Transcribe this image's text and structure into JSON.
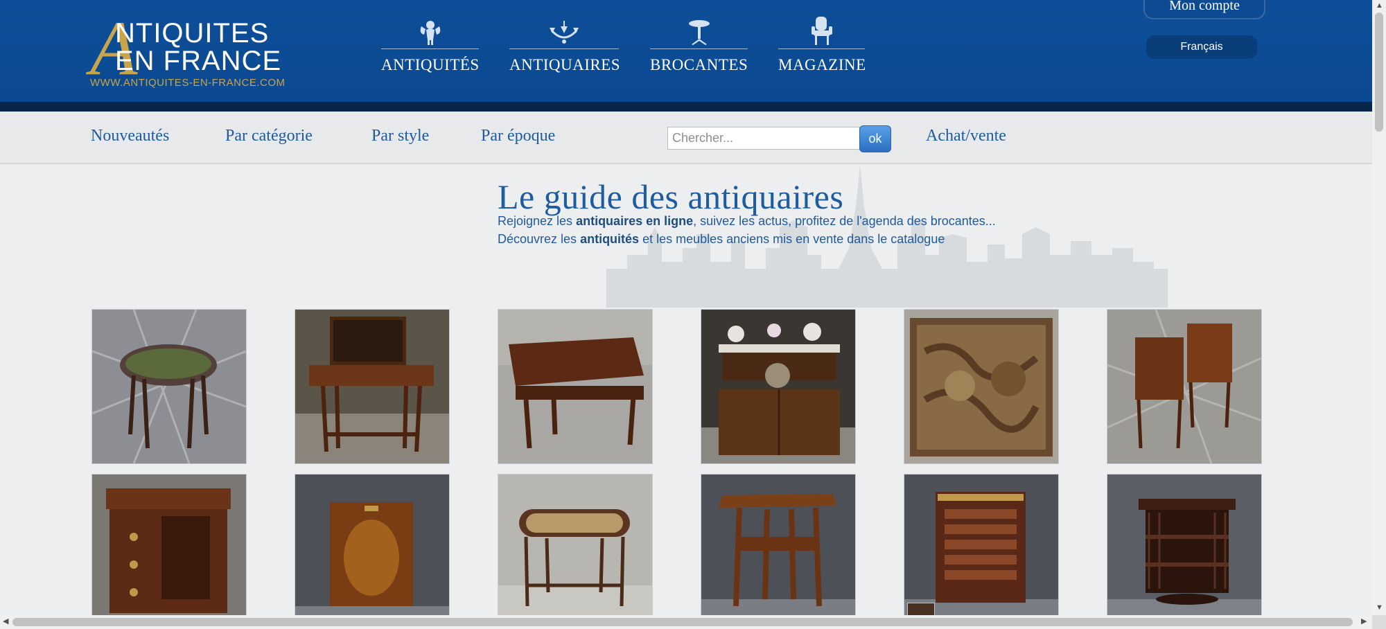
{
  "logo": {
    "letter": "A",
    "line1": "NTIQUITES",
    "line2": "EN FRANCE",
    "url": "WWW.ANTIQUITES-EN-FRANCE.COM"
  },
  "main_nav": [
    {
      "label": "ANTIQUITÉS",
      "icon": "cherub-icon"
    },
    {
      "label": "ANTIQUAIRES",
      "icon": "chandelier-icon"
    },
    {
      "label": "BROCANTES",
      "icon": "gueridon-table-icon"
    },
    {
      "label": "MAGAZINE",
      "icon": "armchair-icon"
    }
  ],
  "account": {
    "label": "Mon compte",
    "language": "Français"
  },
  "subnav": {
    "links": [
      "Nouveautés",
      "Par catégorie",
      "Par style",
      "Par époque"
    ],
    "search_placeholder": "Chercher...",
    "search_button": "ok",
    "buy_sell": "Achat/vente"
  },
  "hero": {
    "title": "Le guide des antiquaires",
    "line1_pre": "Rejoignez les ",
    "line1_bold": "antiquaires en ligne",
    "line1_post": ", suivez les actus, profitez de l'agenda des brocantes...",
    "line2_pre": "Découvrez les ",
    "line2_bold": "antiquités",
    "line2_post": " et les meubles anciens mis en vente dans le catalogue"
  },
  "products": [
    {
      "name": "upholstered-stool",
      "bg": "#8c8e93",
      "wood": "#3a2116"
    },
    {
      "name": "writing-desk",
      "bg": "#5a5548",
      "wood": "#6b3518"
    },
    {
      "name": "games-table",
      "bg": "#a8a7a4",
      "wood": "#5c2a14"
    },
    {
      "name": "marble-top-sideboard",
      "bg": "#3a3632",
      "wood": "#5c3418"
    },
    {
      "name": "tapestry",
      "bg": "#a9a49b",
      "wood": "#5a3a22"
    },
    {
      "name": "bedside-tables-pair",
      "bg": "#9c9a95",
      "wood": "#6a3316"
    },
    {
      "name": "marquetry-commode",
      "bg": "#7b7874",
      "wood": "#5a2a14"
    },
    {
      "name": "burl-cabinet",
      "bg": "#4d5157",
      "wood": "#7a3c12"
    },
    {
      "name": "cane-bench",
      "bg": "#b8b6b1",
      "wood": "#5a3420"
    },
    {
      "name": "side-table",
      "bg": "#4d5157",
      "wood": "#7a4018"
    },
    {
      "name": "wine-cabinet",
      "bg": "#4d5157",
      "wood": "#5a2816"
    },
    {
      "name": "revolving-bookcase",
      "bg": "#5b5f65",
      "wood": "#3e1e12"
    }
  ],
  "colors": {
    "brand_blue": "#0e4e98",
    "gold": "#c8a54a",
    "link_blue": "#1f5a9c"
  }
}
